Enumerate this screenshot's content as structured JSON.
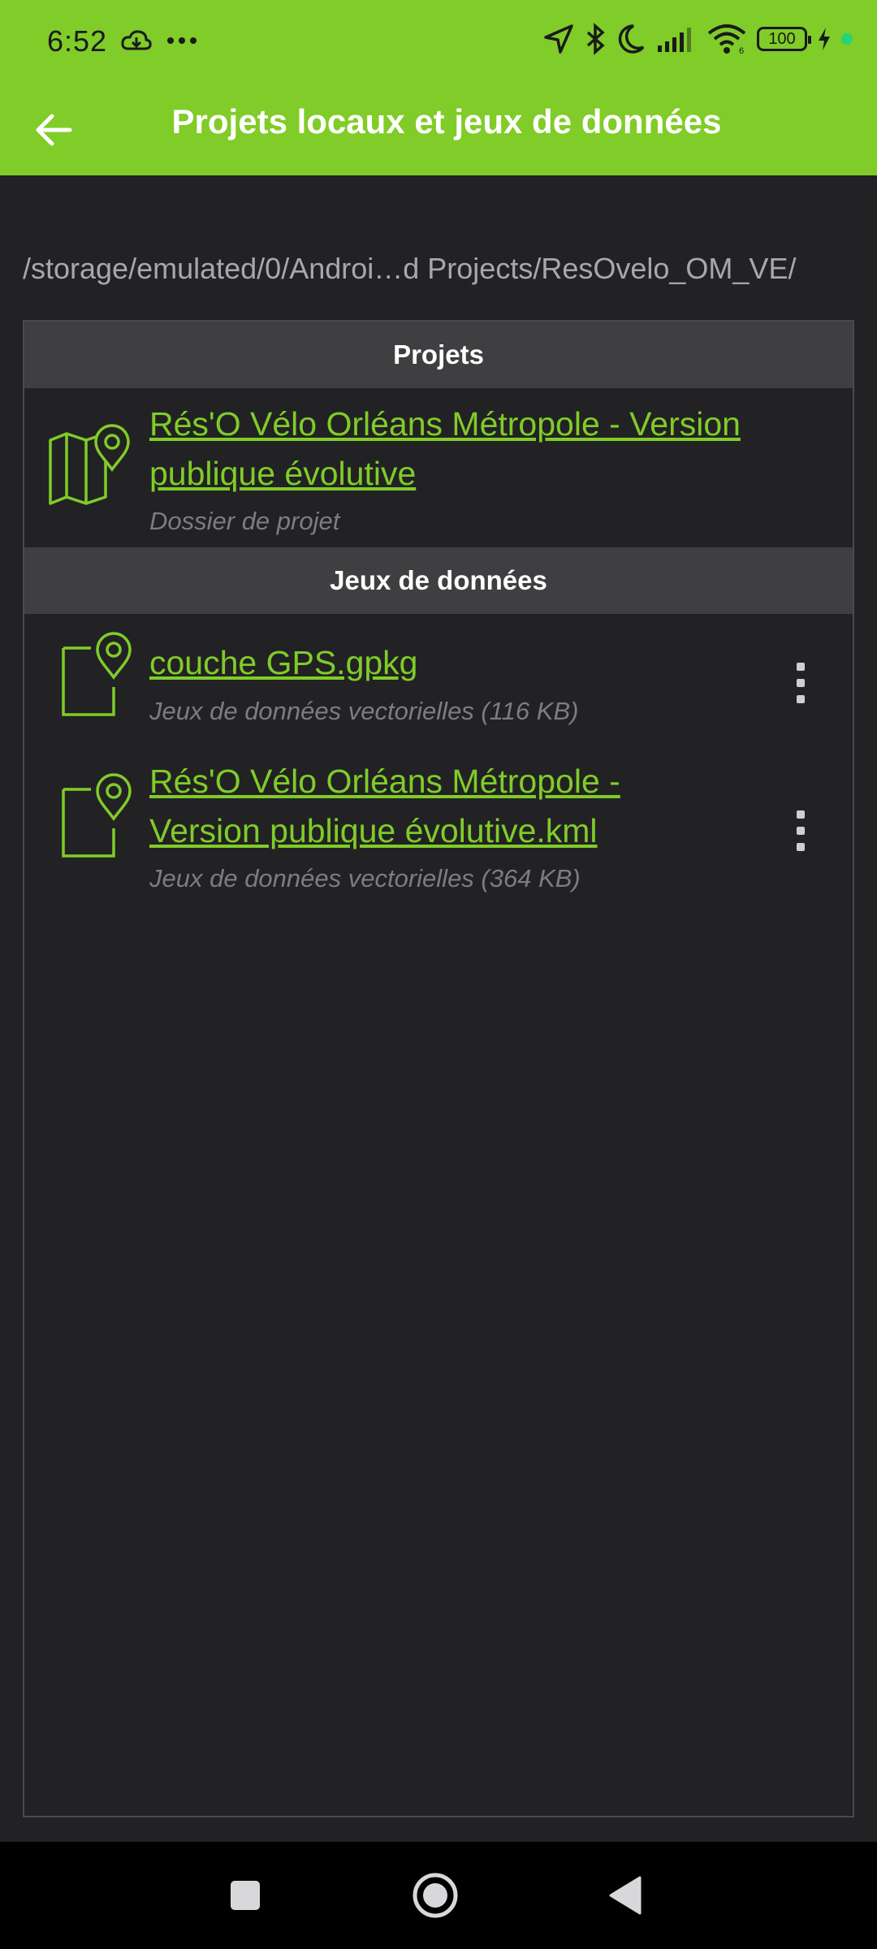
{
  "status": {
    "time": "6:52",
    "battery": "100",
    "signal_label": "6"
  },
  "appbar": {
    "title": "Projets locaux et jeux de données",
    "back_icon": "arrow-back-icon"
  },
  "path": "/storage/emulated/0/Androi…d Projects/ResOvelo_OM_VE/",
  "sections": {
    "projects_header": "Projets",
    "datasets_header": "Jeux de données"
  },
  "projects": [
    {
      "title_line1": "Rés'O Vélo Orléans Métropole - Version",
      "title_line2": "publique évolutive",
      "subtitle": "Dossier de projet",
      "icon": "map-folder-icon"
    }
  ],
  "datasets": [
    {
      "title_line1": "couche GPS.gpkg",
      "subtitle": "Jeux de données vectorielles (116 KB)",
      "icon": "vector-file-icon"
    },
    {
      "title_line1": "Rés'O Vélo Orléans Métropole -",
      "title_line2": "Version publique évolutive.kml",
      "subtitle": "Jeux de données vectorielles (364 KB)",
      "icon": "vector-file-icon"
    }
  ],
  "colors": {
    "accent": "#80cc28",
    "background": "#222224",
    "header": "#3f3f41",
    "subtitle": "#7d7d80"
  }
}
